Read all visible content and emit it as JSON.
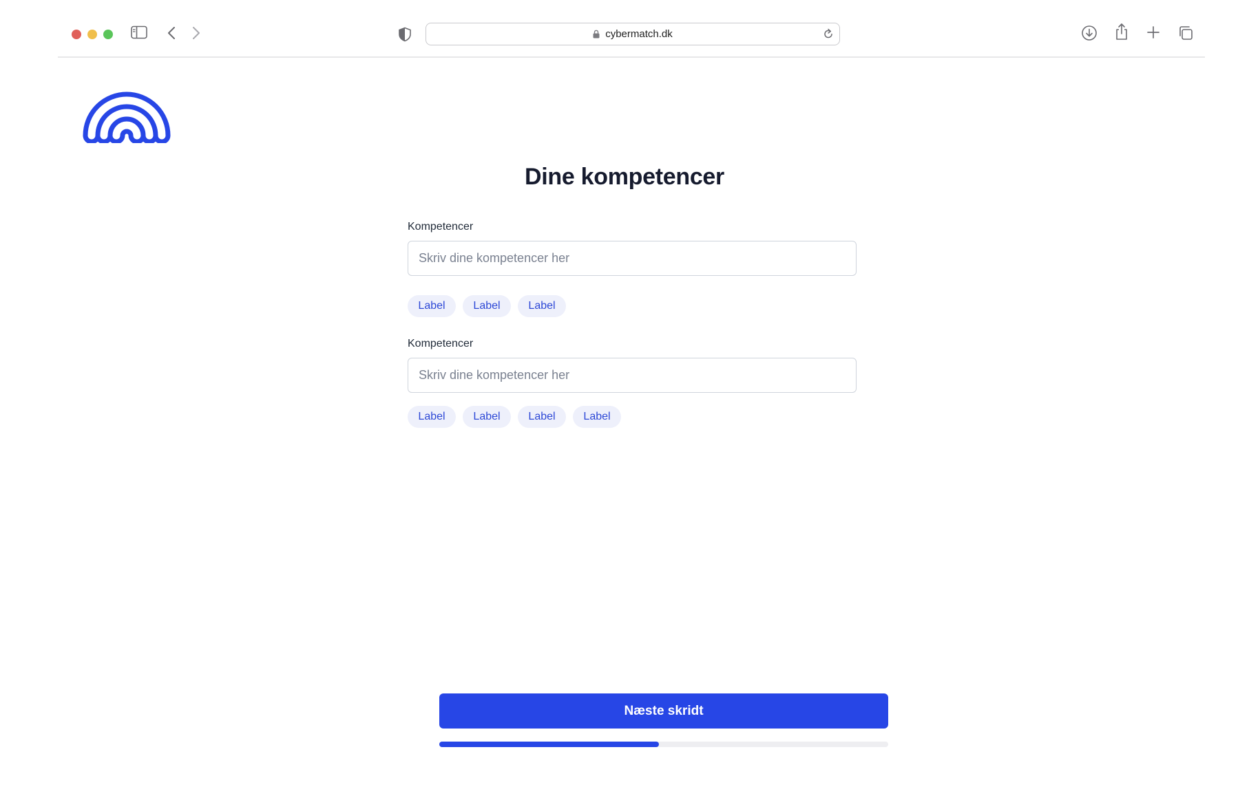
{
  "browser": {
    "url": "cybermatch.dk",
    "traffic_colors": {
      "close": "#e0605a",
      "minimize": "#f0bf4c",
      "maximize": "#5ac55a"
    }
  },
  "page": {
    "title": "Dine kompetencer",
    "fields": [
      {
        "label": "Kompetencer",
        "placeholder": "Skriv dine kompetencer her",
        "value": "",
        "chips": [
          "Label",
          "Label",
          "Label"
        ]
      },
      {
        "label": "Kompetencer",
        "placeholder": "Skriv dine kompetencer her",
        "value": "",
        "chips": [
          "Label",
          "Label",
          "Label",
          "Label"
        ]
      }
    ],
    "next_button": "Næste skridt",
    "progress_fraction": 0.49
  },
  "colors": {
    "accent": "#2746e6",
    "chip_bg": "#eef0fb",
    "chip_text": "#2d48d6"
  },
  "icons": [
    "sidebar-icon",
    "back-icon",
    "forward-icon",
    "shield-icon",
    "lock-icon",
    "reload-icon",
    "download-icon",
    "share-icon",
    "new-tab-icon",
    "tabs-overview-icon",
    "fingerprint-logo"
  ]
}
